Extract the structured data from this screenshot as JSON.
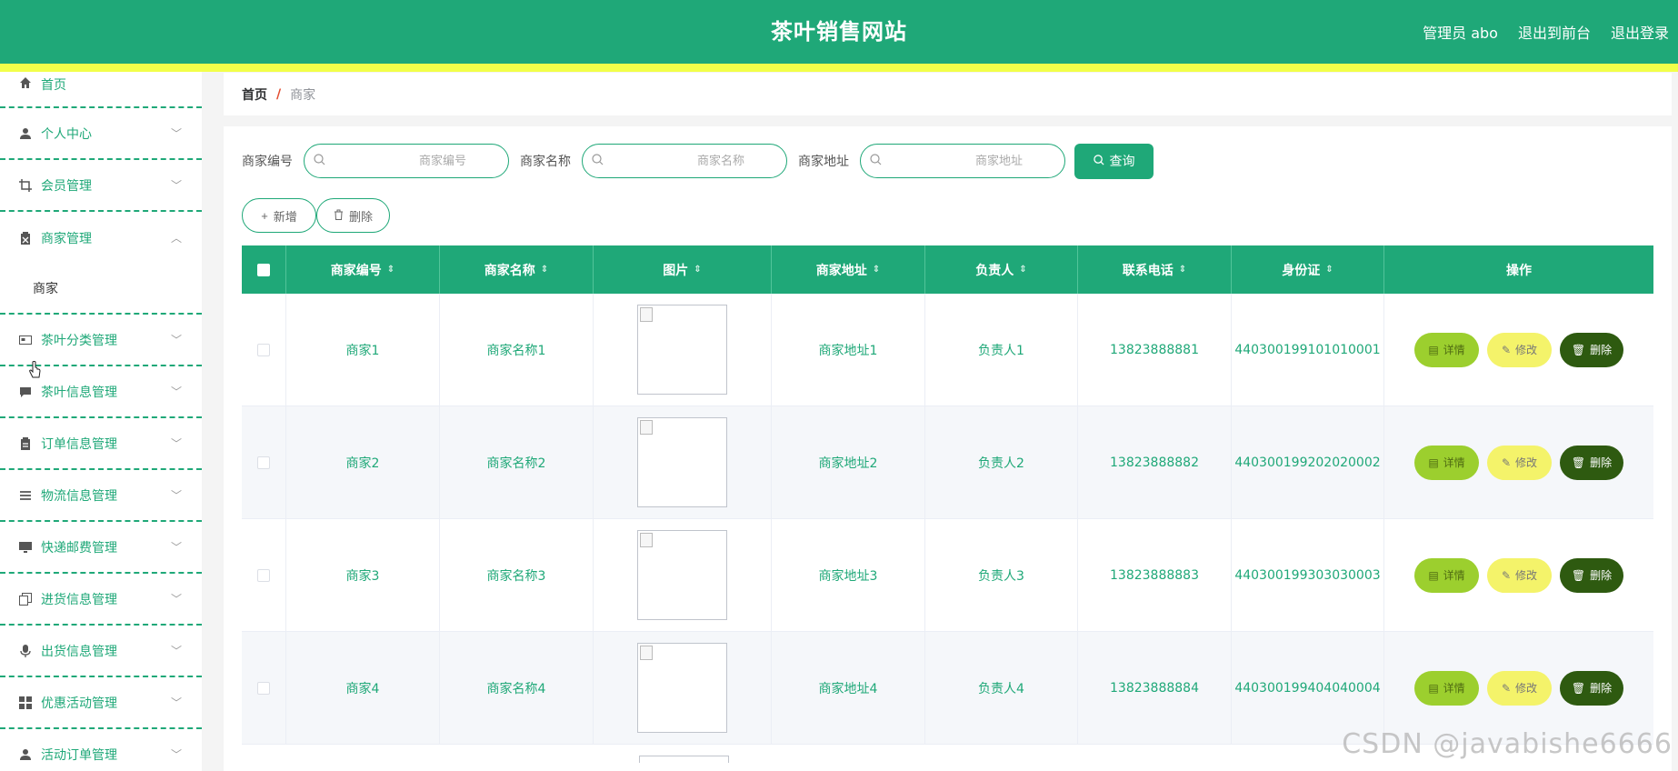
{
  "header": {
    "title": "茶叶销售网站",
    "user_label": "管理员 abo",
    "front_link": "退出到前台",
    "logout_link": "退出登录"
  },
  "sidebar": {
    "items": [
      {
        "label": "首页",
        "icon": "home-icon"
      },
      {
        "label": "个人中心",
        "icon": "user-icon"
      },
      {
        "label": "会员管理",
        "icon": "crop-icon"
      },
      {
        "label": "商家管理",
        "icon": "clipboard-icon"
      },
      {
        "label": "茶叶分类管理",
        "icon": "card-icon"
      },
      {
        "label": "茶叶信息管理",
        "icon": "chat-icon"
      },
      {
        "label": "订单信息管理",
        "icon": "clipboard-icon"
      },
      {
        "label": "物流信息管理",
        "icon": "list-icon"
      },
      {
        "label": "快递邮费管理",
        "icon": "monitor-icon"
      },
      {
        "label": "进货信息管理",
        "icon": "copy-icon"
      },
      {
        "label": "出货信息管理",
        "icon": "microphone-icon"
      },
      {
        "label": "优惠活动管理",
        "icon": "grid-icon"
      },
      {
        "label": "活动订单管理",
        "icon": "user-icon"
      }
    ],
    "submenu_label": "商家"
  },
  "breadcrumb": {
    "home": "首页",
    "separator": "/",
    "current": "商家"
  },
  "search": {
    "field1_label": "商家编号",
    "field1_placeholder": "商家编号",
    "field2_label": "商家名称",
    "field2_placeholder": "商家名称",
    "field3_label": "商家地址",
    "field3_placeholder": "商家地址",
    "query_label": "查询"
  },
  "actions": {
    "add_label": "新增",
    "delete_label": "删除"
  },
  "table": {
    "columns": [
      "商家编号",
      "商家名称",
      "图片",
      "商家地址",
      "负责人",
      "联系电话",
      "身份证",
      "操作"
    ],
    "rows": [
      {
        "id": "商家1",
        "name": "商家名称1",
        "address": "商家地址1",
        "owner": "负责人1",
        "phone": "13823888881",
        "idcard": "440300199101010001"
      },
      {
        "id": "商家2",
        "name": "商家名称2",
        "address": "商家地址2",
        "owner": "负责人2",
        "phone": "13823888882",
        "idcard": "440300199202020002"
      },
      {
        "id": "商家3",
        "name": "商家名称3",
        "address": "商家地址3",
        "owner": "负责人3",
        "phone": "13823888883",
        "idcard": "440300199303030003"
      },
      {
        "id": "商家4",
        "name": "商家名称4",
        "address": "商家地址4",
        "owner": "负责人4",
        "phone": "13823888884",
        "idcard": "440300199404040004"
      }
    ],
    "op_detail": "详情",
    "op_edit": "修改",
    "op_delete": "删除"
  },
  "watermark": "CSDN @javabishe6666",
  "colors": {
    "primary": "#1fa878",
    "accent_yellow": "#f2ff4a",
    "detail_btn": "#9ccf2e",
    "edit_btn": "#f4f36a",
    "delete_btn": "#2e5a10"
  }
}
